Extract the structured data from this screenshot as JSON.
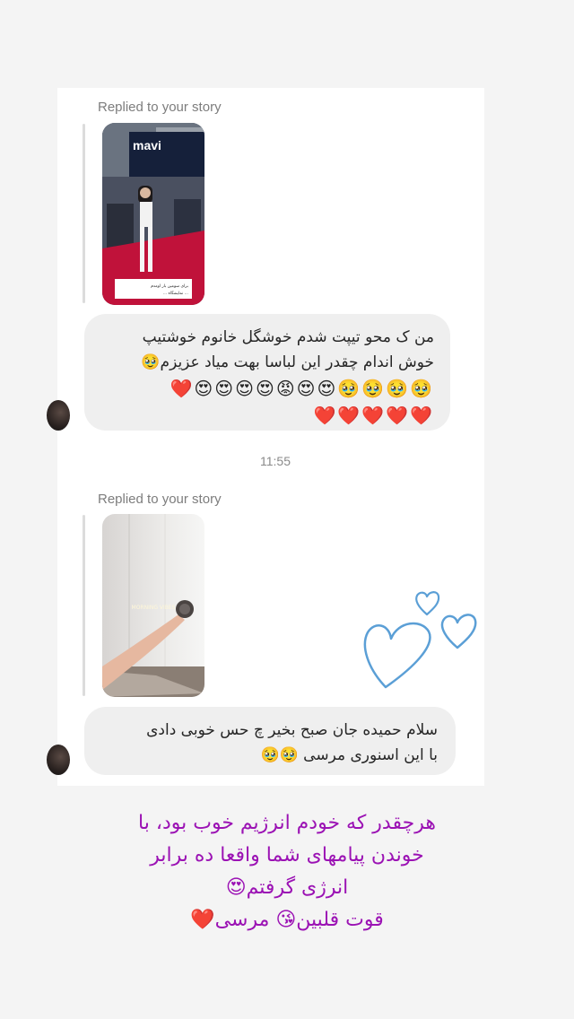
{
  "message1": {
    "replied_label": "Replied to your story",
    "story_brand": "mavi",
    "story_caption_line1": "برای سومین بار اومدم",
    "story_caption_line2": "... نمایشگاه ...",
    "text_line1": "من ک محو تیپت شدم خوشگل خانوم خوشتیپ",
    "text_line2": "خوش اندام چقدر این لباسا بهت میاد عزیزم🥹",
    "emoji_row1": "🥹🥹🥹🥹😍😍😡😍😍😍😍❤️",
    "emoji_row2": "❤️❤️❤️❤️❤️"
  },
  "timestamp": "11:55",
  "message2": {
    "replied_label": "Replied to your story",
    "story_overlay": "MORNING VIBES",
    "text_line1": "سلام حمیده جان صبح بخیر چ حس خوبی دادی",
    "text_line2": "با این اسنوری مرسی 🥹🥹"
  },
  "caption": {
    "line1": "هرچقدر که خودم انرژیم خوب بود، با",
    "line2": "خوندن پیامهای شما واقعا ده برابر",
    "line3": "انرژی گرفتم😍",
    "line4": "قوت قلبین😘 مرسی❤️"
  },
  "colors": {
    "caption": "#9b12b4",
    "doodle_hearts": "#5b9fd6",
    "bubble": "#efefef"
  }
}
